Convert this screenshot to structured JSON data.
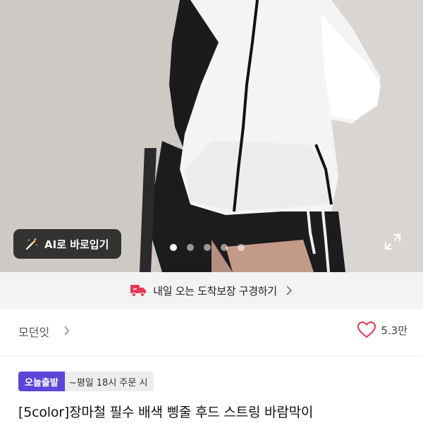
{
  "hero": {
    "ai_button_label": "AI로 바로입기",
    "carousel_total": 5,
    "carousel_active_index": 0
  },
  "delivery_banner": {
    "text": "내일 오는 도착보장 구경하기",
    "accent_color": "#e8384f"
  },
  "shop": {
    "name": "모던잇",
    "like_count": "5.3만",
    "heart_color": "#e8384f"
  },
  "product": {
    "badge": "오늘출발",
    "badge_note": "~평일 18시 주문 시",
    "badge_color": "#5c45d8",
    "title": "[5color]장마철 필수 배색 삥줄 후드 스트링 바람막이"
  }
}
